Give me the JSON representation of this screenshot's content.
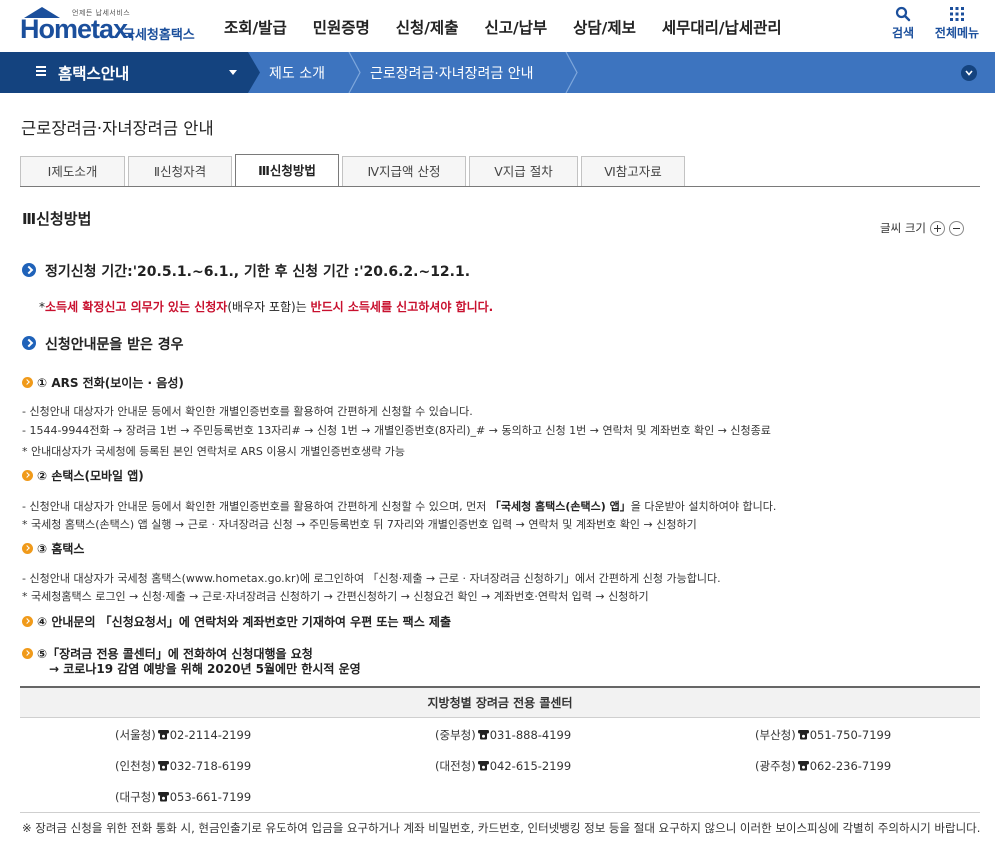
{
  "header": {
    "logo": {
      "tagline": "언제든 납세서비스",
      "brand": "Hometax.",
      "org": "국세청홈택스"
    },
    "gnb": [
      "조회/발급",
      "민원증명",
      "신청/제출",
      "신고/납부",
      "상담/제보",
      "세무대리/납세관리"
    ],
    "search_label": "검색",
    "all_menu_label": "전체메뉴"
  },
  "navbar": {
    "section": "홈택스안내",
    "crumbs": [
      "제도 소개",
      "근로장려금·자녀장려금 안내"
    ]
  },
  "page_title": "근로장려금·자녀장려금 안내",
  "tabs": [
    {
      "label": "Ⅰ제도소개",
      "active": false
    },
    {
      "label": "Ⅱ신청자격",
      "active": false
    },
    {
      "label": "Ⅲ신청방법",
      "active": true
    },
    {
      "label": "Ⅳ지급액 산정",
      "active": false
    },
    {
      "label": "Ⅴ지급 절차",
      "active": false
    },
    {
      "label": "Ⅵ참고자료",
      "active": false
    }
  ],
  "section_title": "Ⅲ신청방법",
  "font_size_label": "글씨 크기",
  "period": "정기신청 기간:'20.5.1.~6.1., 기한 후 신청 기간 :'20.6.2.~12.1.",
  "note": {
    "prefix": "*",
    "red1": "소득세 확정신고 의무가 있는 신청자",
    "mid": "(배우자 포함)는 ",
    "red2": "반드시 소득세를 신고하셔야 합니다."
  },
  "notice_heading": "신청안내문을 받은 경우",
  "methods": {
    "ars": {
      "title": "① ARS 전화(보이는 · 음성)",
      "lines": [
        "- 신청안내 대상자가 안내문 등에서 확인한 개별인증번호를 활용하여 간편하게 신청할 수 있습니다.",
        "- 1544-9944전화 → 장려금 1번 → 주민등록번호 13자리# → 신청 1번 → 개별인증번호(8자리)_# → 동의하고 신청 1번 → 연락처 및 계좌번호 확인 → 신청종료",
        "* 안내대상자가 국세청에 등록된 본인 연락처로 ARS 이용시 개별인증번호생략 가능"
      ]
    },
    "sontax": {
      "title": "② 손택스(모바일 앱)",
      "line1_a": "- 신청안내 대상자가 안내문 등에서 확인한 개별인증번호를 활용하여 간편하게 신청할 수 있으며, 먼저 ",
      "line1_b": "「국세청 홈택스(손택스) 앱」",
      "line1_c": "을 다운받아 설치하여야 합니다.",
      "line2": " * 국세청 홈택스(손택스) 앱 실행 → 근로 · 자녀장려금 신청 → 주민등록번호 뒤 7자리와 개별인증번호 입력 → 연락처 및 계좌번호 확인 → 신청하기"
    },
    "hometax": {
      "title": "③ 홈택스",
      "lines": [
        "- 신청안내 대상자가 국세청 홈택스(www.hometax.go.kr)에 로그인하여 「신청·제출 → 근로 · 자녀장려금 신청하기」에서 간편하게 신청 가능합니다.",
        " * 국세청홈택스 로그인 → 신청·제출 → 근로·자녀장려금 신청하기 → 간편신청하기 → 신청요건 확인 → 계좌번호·연락처 입력 → 신청하기"
      ]
    },
    "mail": {
      "title": "④ 안내문의 「신청요청서」에 연락처와 계좌번호만 기재하여 우편 또는 팩스 제출"
    },
    "callcenter": {
      "title": "⑤「장려금 전용 콜센터」에 전화하여 신청대행을 요청",
      "sub": "→ 코로나19 감염 예방을 위해 2020년 5월에만 한시적 운영"
    }
  },
  "call_center": {
    "heading": "지방청별 장려금 전용 콜센터",
    "rows": [
      [
        {
          "office": "(서울청)",
          "phone": "02-2114-2199"
        },
        {
          "office": "(중부청)",
          "phone": "031-888-4199"
        },
        {
          "office": "(부산청)",
          "phone": "051-750-7199"
        }
      ],
      [
        {
          "office": "(인천청)",
          "phone": "032-718-6199"
        },
        {
          "office": "(대전청)",
          "phone": "042-615-2199"
        },
        {
          "office": "(광주청)",
          "phone": "062-236-7199"
        }
      ],
      [
        {
          "office": "(대구청)",
          "phone": "053-661-7199"
        }
      ]
    ]
  },
  "warning": "※ 장려금 신청을 위한 전화 통화 시, 현금인출기로 유도하여 입금을 요구하거나 계좌 비밀번호, 카드번호, 인터넷뱅킹 정보 등을 절대 요구하지 않으니 이러한 보이스피싱에 각별히 주의하시기 바랍니다.",
  "colors": {
    "primary": "#1b4f9c",
    "navbar": "#3d74bf",
    "navbar_dark": "#14437f",
    "red": "#c8102e",
    "orange_bullet": "#f09a1a"
  }
}
